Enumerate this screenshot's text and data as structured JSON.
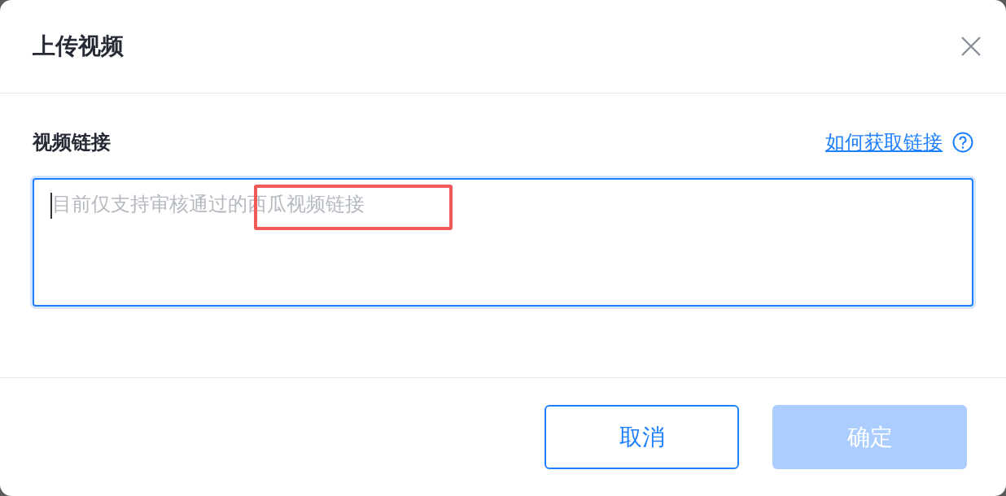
{
  "dialog": {
    "title": "上传视频"
  },
  "field": {
    "label": "视频链接",
    "help_link": "如何获取链接",
    "placeholder": "目前仅支持审核通过的西瓜视频链接",
    "focused": true,
    "highlight": true
  },
  "buttons": [
    {
      "label": "取消",
      "kind": "secondary",
      "disabled": false
    },
    {
      "label": "确定",
      "kind": "primary",
      "disabled": true
    }
  ]
}
